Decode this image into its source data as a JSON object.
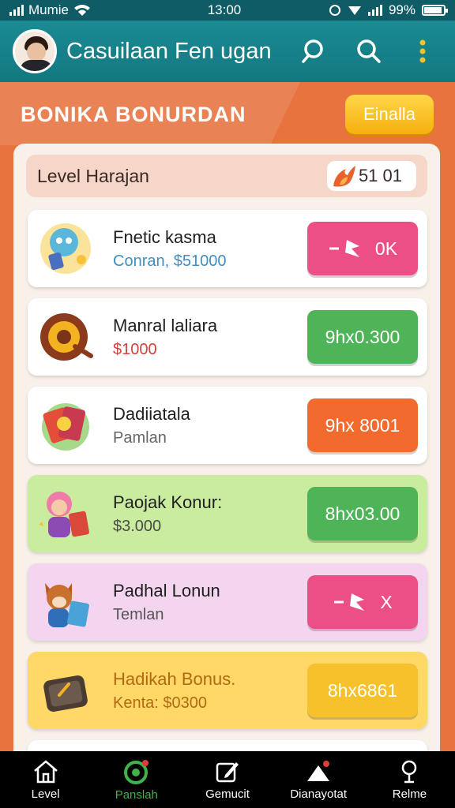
{
  "status_bar": {
    "carrier": "Mumie",
    "time": "13:00",
    "battery": "99%"
  },
  "app_bar": {
    "title": "Casuilaan Fen ugan"
  },
  "banner": {
    "title": "BONIKA BONURDAN",
    "button_label": "Einalla"
  },
  "level": {
    "label": "Level Harajan",
    "value": "51 01"
  },
  "cards": [
    {
      "name": "Fnetic kasma",
      "sub": "Conran, $51000",
      "action": "0K",
      "sub_color": "#3f8fc0",
      "action_color": "#ec4f86",
      "bg": "#ffffff",
      "icon": "robot-icon"
    },
    {
      "name": "Manral laliara",
      "sub": "$1000",
      "action": "9hx0.300",
      "sub_color": "#d0443c",
      "action_color": "#4eb457",
      "bg": "#ffffff",
      "icon": "gong-icon"
    },
    {
      "name": "Dadiiatala",
      "sub": "Pamlan",
      "action": "9hx 8001",
      "sub_color": "#666666",
      "action_color": "#f26a2e",
      "bg": "#ffffff",
      "icon": "cards-icon"
    },
    {
      "name": "Paojak Konur:",
      "sub": "$3.000",
      "action": "8hx03.00",
      "sub_color": "#4b4b4b",
      "action_color": "#4eb457",
      "bg": "#c9ec9f",
      "icon": "girl-character-icon"
    },
    {
      "name": "Padhal Lonun",
      "sub": "Temlan",
      "action": "X",
      "sub_color": "#555555",
      "action_color": "#ec4f86",
      "bg": "#f3d5ef",
      "icon": "fox-character-icon"
    },
    {
      "name": "Hadikah Bonus.",
      "sub": "Kenta: $0300",
      "action": "8hx6861",
      "sub_color": "#b26a12",
      "action_color": "#f7c12c",
      "bg": "#ffd868",
      "icon": "treasure-box-icon"
    }
  ],
  "nav": [
    {
      "label": "Level",
      "icon": "home-icon"
    },
    {
      "label": "Panslah",
      "icon": "target-icon"
    },
    {
      "label": "Gemucit",
      "icon": "edit-icon"
    },
    {
      "label": "Dianayotat",
      "icon": "notification-icon"
    },
    {
      "label": "Relme",
      "icon": "profile-icon"
    }
  ]
}
